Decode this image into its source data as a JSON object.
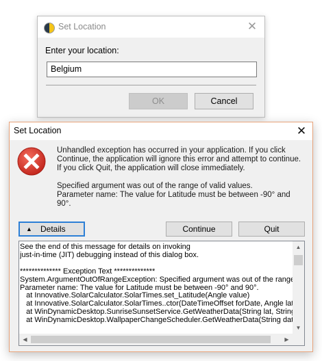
{
  "location_dialog": {
    "title": "Set Location",
    "prompt": "Enter your location:",
    "input_value": "Belgium",
    "ok_label": "OK",
    "cancel_label": "Cancel",
    "close_glyph": "✕"
  },
  "error_dialog": {
    "title": "Set Location",
    "close_glyph": "✕",
    "message_1": "Unhandled exception has occurred in your application. If you click Continue, the application will ignore this error and attempt to continue. If you click Quit, the application will close immediately.",
    "message_2_line_1": "Specified argument was out of the range of valid values.",
    "message_2_line_2": "Parameter name: The value for Latitude must be between -90° and 90°.",
    "details_label": "Details",
    "details_glyph": "▲",
    "continue_label": "Continue",
    "quit_label": "Quit",
    "details_text": "See the end of this message for details on invoking\njust-in-time (JIT) debugging instead of this dialog box.\n\n************** Exception Text **************\nSystem.ArgumentOutOfRangeException: Specified argument was out of the range of\nParameter name: The value for Latitude must be between -90° and 90°.\n   at Innovative.SolarCalculator.SolarTimes.set_Latitude(Angle value)\n   at Innovative.SolarCalculator.SolarTimes..ctor(DateTimeOffset forDate, Angle latitu\n   at WinDynamicDesktop.SunriseSunsetService.GetWeatherData(String lat, String lo\n   at WinDynamicDesktop.WallpaperChangeScheduler.GetWeatherData(String dateS"
  },
  "colors": {
    "error_icon_red": "#d93a2b",
    "focus_blue": "#2c7fd6",
    "dialog_border": "#e8a37a"
  }
}
